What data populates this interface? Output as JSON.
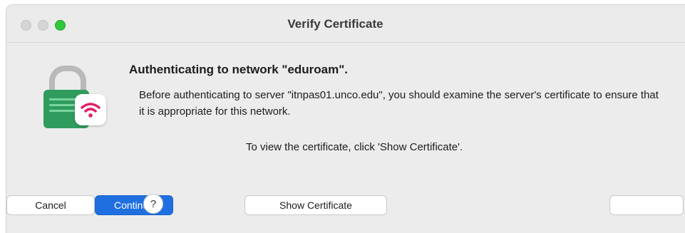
{
  "window": {
    "title": "Verify Certificate"
  },
  "dialog": {
    "heading": "Authenticating to network \"eduroam\".",
    "body": "Before authenticating to server \"itnpas01.unco.edu\", you should examine the server's certificate to ensure that it is appropriate for this network.",
    "hint": "To view the certificate, click 'Show Certificate'."
  },
  "icons": {
    "lock": "lock-icon",
    "wifi": "wifi-icon"
  },
  "buttons": {
    "cancel": "Cancel",
    "continue": "Continue",
    "help": "?",
    "show_certificate": "Show Certificate",
    "right": ""
  },
  "colors": {
    "accent": "#1f6fe0",
    "zoom_button": "#2fc73b",
    "lock_body": "#2f9c5e",
    "wifi_badge": "#e0206a"
  }
}
